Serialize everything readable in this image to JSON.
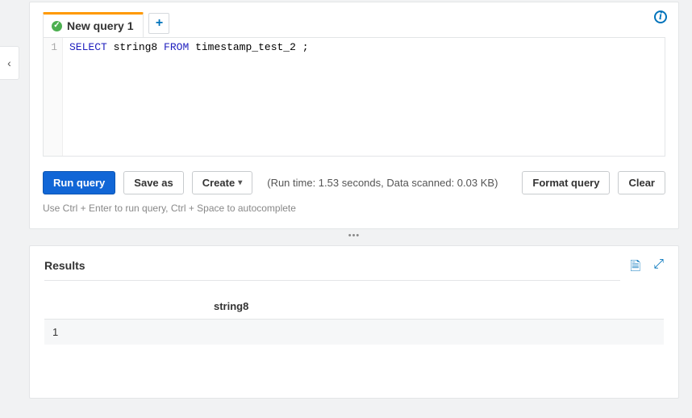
{
  "side": {
    "chevron": "‹"
  },
  "info_glyph": "i",
  "tabs": {
    "active": {
      "label": "New query 1",
      "check_glyph": "✓"
    },
    "add_glyph": "+"
  },
  "editor": {
    "line_number": "1",
    "kw_select": "SELECT",
    "col": "string8",
    "kw_from": "FROM",
    "table": "timestamp_test_2",
    "tail": " ;"
  },
  "toolbar": {
    "run_label": "Run query",
    "save_label": "Save as",
    "create_label": "Create",
    "runinfo": "(Run time: 1.53 seconds, Data scanned: 0.03 KB)",
    "format_label": "Format query",
    "clear_label": "Clear"
  },
  "hint": "Use Ctrl + Enter to run query, Ctrl + Space to autocomplete",
  "divider_glyph": "•••",
  "results": {
    "title": "Results",
    "download_glyph": "🗎",
    "expand_glyph": "⤢",
    "columns": {
      "rownum": "",
      "c1": "string8"
    },
    "rows": [
      {
        "rownum": "1",
        "c1": ""
      }
    ]
  }
}
